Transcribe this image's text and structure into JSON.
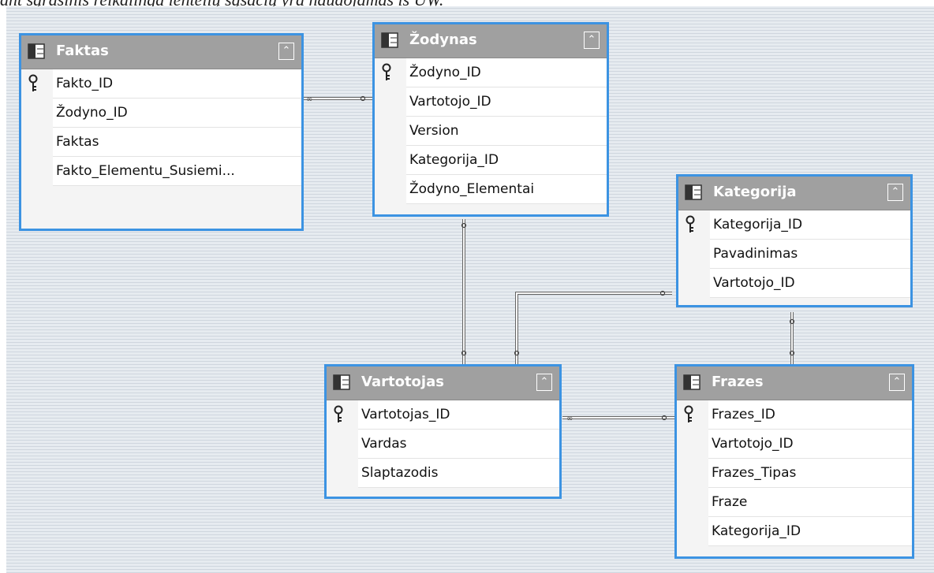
{
  "caption": "ant sąrašinis reikalinga lentelių sąsačių yra naudojamas iš UW.",
  "colors": {
    "border": "#3c93e2",
    "header": "#a0a0a0"
  },
  "tables": [
    {
      "id": "faktas",
      "title": "Faktas",
      "collapse_icon": "collapse-up-icon",
      "fields": [
        {
          "name": "Fakto_ID",
          "key": true
        },
        {
          "name": "Žodyno_ID",
          "key": false
        },
        {
          "name": "Faktas",
          "key": false
        },
        {
          "name": "Fakto_Elementu_Susiemi...",
          "key": false
        }
      ]
    },
    {
      "id": "zodynas",
      "title": "Žodynas",
      "collapse_icon": "collapse-up-icon",
      "fields": [
        {
          "name": "Žodyno_ID",
          "key": true
        },
        {
          "name": "Vartotojo_ID",
          "key": false
        },
        {
          "name": "Version",
          "key": false
        },
        {
          "name": "Kategorija_ID",
          "key": false
        },
        {
          "name": "Žodyno_Elementai",
          "key": false
        }
      ]
    },
    {
      "id": "kategorija",
      "title": "Kategorija",
      "collapse_icon": "collapse-up-icon",
      "fields": [
        {
          "name": "Kategorija_ID",
          "key": true
        },
        {
          "name": "Pavadinimas",
          "key": false
        },
        {
          "name": "Vartotojo_ID",
          "key": false
        }
      ]
    },
    {
      "id": "vartotojas",
      "title": "Vartotojas",
      "collapse_icon": "collapse-up-icon",
      "fields": [
        {
          "name": "Vartotojas_ID",
          "key": true
        },
        {
          "name": "Vardas",
          "key": false
        },
        {
          "name": "Slaptazodis",
          "key": false
        }
      ]
    },
    {
      "id": "frazes",
      "title": "Frazes",
      "collapse_icon": "collapse-up-icon",
      "fields": [
        {
          "name": "Frazes_ID",
          "key": true
        },
        {
          "name": "Vartotojo_ID",
          "key": false
        },
        {
          "name": "Frazes_Tipas",
          "key": false
        },
        {
          "name": "Fraze",
          "key": false
        },
        {
          "name": "Kategorija_ID",
          "key": false
        }
      ]
    }
  ],
  "relationships": [
    {
      "from": "faktas",
      "to": "zodynas"
    },
    {
      "from": "vartotojas",
      "to": "zodynas"
    },
    {
      "from": "vartotojas",
      "to": "kategorija"
    },
    {
      "from": "frazes",
      "to": "kategorija"
    },
    {
      "from": "vartotojas",
      "to": "frazes"
    }
  ]
}
